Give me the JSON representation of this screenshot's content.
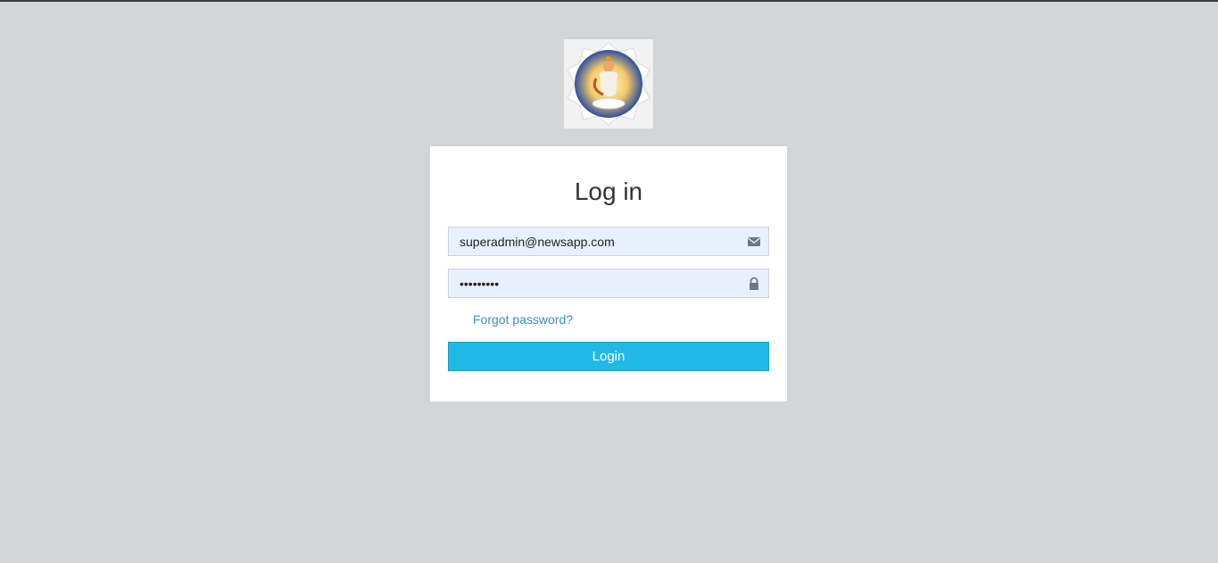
{
  "logo": {
    "icon": "deity-emblem-logo"
  },
  "login_box": {
    "title": "Log in",
    "email": {
      "value": "superadmin@newsapp.com",
      "icon": "envelope-icon"
    },
    "password": {
      "value": "•••••••••",
      "icon": "lock-icon"
    },
    "forgot_link": "Forgot password?",
    "submit_label": "Login"
  },
  "colors": {
    "background": "#d2d6d9",
    "card": "#ffffff",
    "input_fill": "#e8f0fe",
    "link": "#3c8dbc",
    "button": "#22b8e6"
  }
}
